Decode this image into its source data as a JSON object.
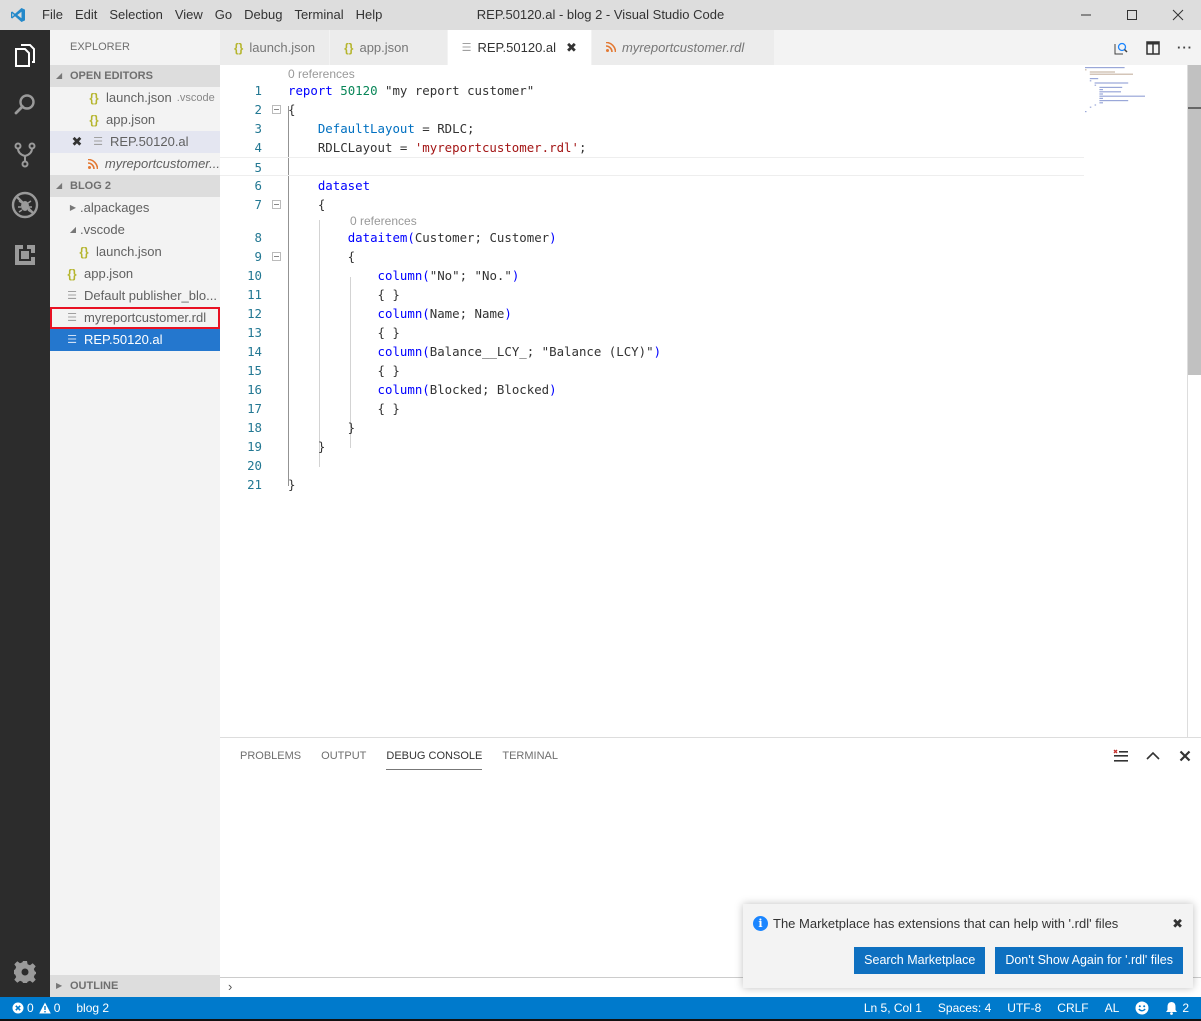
{
  "window": {
    "title": "REP.50120.al - blog 2 - Visual Studio Code",
    "menu": [
      "File",
      "Edit",
      "Selection",
      "View",
      "Go",
      "Debug",
      "Terminal",
      "Help"
    ],
    "controls": {
      "minimize": "minimize-icon",
      "maximize": "maximize-icon",
      "close": "close-icon"
    }
  },
  "activity_bar": {
    "items": [
      {
        "name": "explorer",
        "icon": "files-icon"
      },
      {
        "name": "search",
        "icon": "search-icon"
      },
      {
        "name": "source-control",
        "icon": "source-control-icon"
      },
      {
        "name": "debug",
        "icon": "debug-icon"
      },
      {
        "name": "extensions",
        "icon": "extensions-icon"
      }
    ],
    "bottom": {
      "name": "manage",
      "icon": "gear-icon"
    }
  },
  "sidebar": {
    "title": "EXPLORER",
    "open_editors": {
      "label": "OPEN EDITORS",
      "items": [
        {
          "name": "launch.json",
          "desc": ".vscode",
          "icon": "json-icon"
        },
        {
          "name": "app.json",
          "desc": "",
          "icon": "json-icon"
        },
        {
          "name": "REP.50120.al",
          "desc": "",
          "icon": "file-lines-icon",
          "active": true
        },
        {
          "name": "myreportcustomer...",
          "desc": "",
          "icon": "rss-icon",
          "italic": true
        }
      ]
    },
    "folder": {
      "label": "BLOG 2",
      "items": [
        {
          "name": ".alpackages",
          "type": "folder",
          "expanded": false
        },
        {
          "name": ".vscode",
          "type": "folder",
          "expanded": true
        },
        {
          "name": "launch.json",
          "type": "file",
          "icon": "json-icon"
        },
        {
          "name": "app.json",
          "type": "file",
          "icon": "json-icon"
        },
        {
          "name": "Default publisher_blo...",
          "type": "file",
          "icon": "file-lines-icon"
        },
        {
          "name": "myreportcustomer.rdl",
          "type": "file",
          "icon": "file-lines-icon",
          "highlighted": true
        },
        {
          "name": "REP.50120.al",
          "type": "file",
          "icon": "file-lines-icon",
          "selected": true
        }
      ]
    },
    "outline_label": "OUTLINE"
  },
  "tabs": [
    {
      "label": "launch.json",
      "icon": "json-icon"
    },
    {
      "label": "app.json",
      "icon": "json-icon"
    },
    {
      "label": "REP.50120.al",
      "icon": "file-lines-icon",
      "active": true
    },
    {
      "label": "myreportcustomer.rdl",
      "icon": "rss-icon",
      "italic": true
    }
  ],
  "editor": {
    "codelens": "0 references",
    "lines": [
      "report 50120 \"my report customer\"",
      "{",
      "    DefaultLayout = RDLC;",
      "    RDLCLayout = 'myreportcustomer.rdl';",
      "",
      "    dataset",
      "    {",
      "        dataitem(Customer; Customer)",
      "        {",
      "            column(\"No\"; \"No.\")",
      "            { }",
      "            column(Name; Name)",
      "            { }",
      "            column(Balance__LCY_; \"Balance (LCY)\")",
      "            { }",
      "            column(Blocked; Blocked)",
      "            { }",
      "        }",
      "    }",
      "",
      "}"
    ],
    "line_numbers": [
      "1",
      "2",
      "3",
      "4",
      "5",
      "6",
      "7",
      "8",
      "9",
      "10",
      "11",
      "12",
      "13",
      "14",
      "15",
      "16",
      "17",
      "18",
      "19",
      "20",
      "21"
    ]
  },
  "panel": {
    "tabs": [
      "PROBLEMS",
      "OUTPUT",
      "DEBUG CONSOLE",
      "TERMINAL"
    ],
    "active_tab": "DEBUG CONSOLE",
    "input_prompt": "›"
  },
  "notification": {
    "message": "The Marketplace has extensions that can help with '.rdl' files",
    "buttons": [
      "Search Marketplace",
      "Don't Show Again for '.rdl' files"
    ]
  },
  "statusbar": {
    "errors": "0",
    "warnings": "0",
    "folder": "blog 2",
    "position": "Ln 5, Col 1",
    "spaces": "Spaces: 4",
    "encoding": "UTF-8",
    "eol": "CRLF",
    "language": "AL",
    "notifications": "2"
  },
  "colors": {
    "accent": "#007acc",
    "selection": "#2477ce",
    "highlight_box": "#e81123",
    "button": "#0e70c0"
  }
}
